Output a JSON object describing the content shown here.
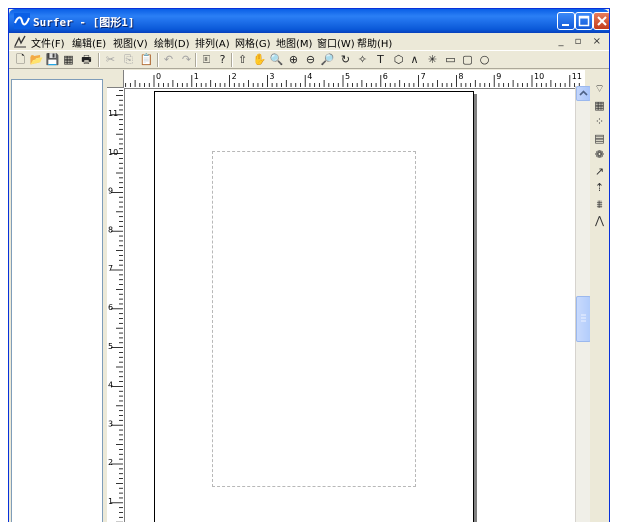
{
  "window": {
    "title": "Surfer - [图形1]"
  },
  "menu": [
    "文件(F)",
    "编辑(E)",
    "视图(V)",
    "绘制(D)",
    "排列(A)",
    "网格(G)",
    "地图(M)",
    "窗口(W)",
    "帮助(H)"
  ],
  "mdi_controls": "_ ▫ ×",
  "toolbar": [
    {
      "icon": "new-file-icon",
      "glyph": "🗋"
    },
    {
      "icon": "open-folder-icon",
      "glyph": "📂"
    },
    {
      "icon": "save-icon",
      "glyph": "💾"
    },
    {
      "icon": "worksheet-icon",
      "glyph": "▦"
    },
    {
      "icon": "print-icon",
      "glyph": "🖶"
    },
    {
      "icon": "cut-icon",
      "glyph": "✂"
    },
    {
      "icon": "copy-icon",
      "glyph": "⎘"
    },
    {
      "icon": "paste-icon",
      "glyph": "📋"
    },
    {
      "icon": "undo-icon",
      "glyph": "↶"
    },
    {
      "icon": "redo-icon",
      "glyph": "↷"
    },
    {
      "icon": "object-manager-icon",
      "glyph": "🗉"
    },
    {
      "icon": "context-help-icon",
      "glyph": "?"
    },
    {
      "icon": "select-arrow-icon",
      "glyph": "⇧"
    },
    {
      "icon": "pan-hand-icon",
      "glyph": "✋"
    },
    {
      "icon": "zoom-rect-icon",
      "glyph": "🔍"
    },
    {
      "icon": "zoom-in-icon",
      "glyph": "⊕"
    },
    {
      "icon": "zoom-out-icon",
      "glyph": "⊖"
    },
    {
      "icon": "zoom-fit-icon",
      "glyph": "🔎"
    },
    {
      "icon": "rotate-icon",
      "glyph": "↻"
    },
    {
      "icon": "reshape-icon",
      "glyph": "✧"
    },
    {
      "icon": "text-icon",
      "glyph": "T"
    },
    {
      "icon": "polygon-icon",
      "glyph": "⬡"
    },
    {
      "icon": "polyline-icon",
      "glyph": "∧"
    },
    {
      "icon": "symbol-icon",
      "glyph": "✳"
    },
    {
      "icon": "rectangle-icon",
      "glyph": "▭"
    },
    {
      "icon": "rounded-rectangle-icon",
      "glyph": "▢"
    },
    {
      "icon": "ellipse-icon",
      "glyph": "○"
    }
  ],
  "ruler": {
    "h_labels": [
      "0",
      "1",
      "2",
      "3",
      "4",
      "5",
      "6",
      "7",
      "8",
      "9",
      "10",
      "11"
    ],
    "v_labels": [
      "11",
      "10",
      "9",
      "8",
      "7",
      "6",
      "5",
      "4",
      "3",
      "2",
      "1"
    ]
  },
  "right_tools": [
    {
      "icon": "contour-map-icon",
      "glyph": "⌔"
    },
    {
      "icon": "base-map-icon",
      "glyph": "▦"
    },
    {
      "icon": "post-map-icon",
      "glyph": "⁘"
    },
    {
      "icon": "image-map-icon",
      "glyph": "▤"
    },
    {
      "icon": "shaded-relief-icon",
      "glyph": "❁"
    },
    {
      "icon": "vector-map-icon",
      "glyph": "↗"
    },
    {
      "icon": "classed-post-icon",
      "glyph": "⇡"
    },
    {
      "icon": "wireframe-icon",
      "glyph": "⩩"
    },
    {
      "icon": "surface-icon",
      "glyph": "⋀"
    }
  ],
  "colors": {
    "title_bar": "#0a5fe6",
    "window_bg": "#ece9d8",
    "close_button": "#c43c1a"
  }
}
